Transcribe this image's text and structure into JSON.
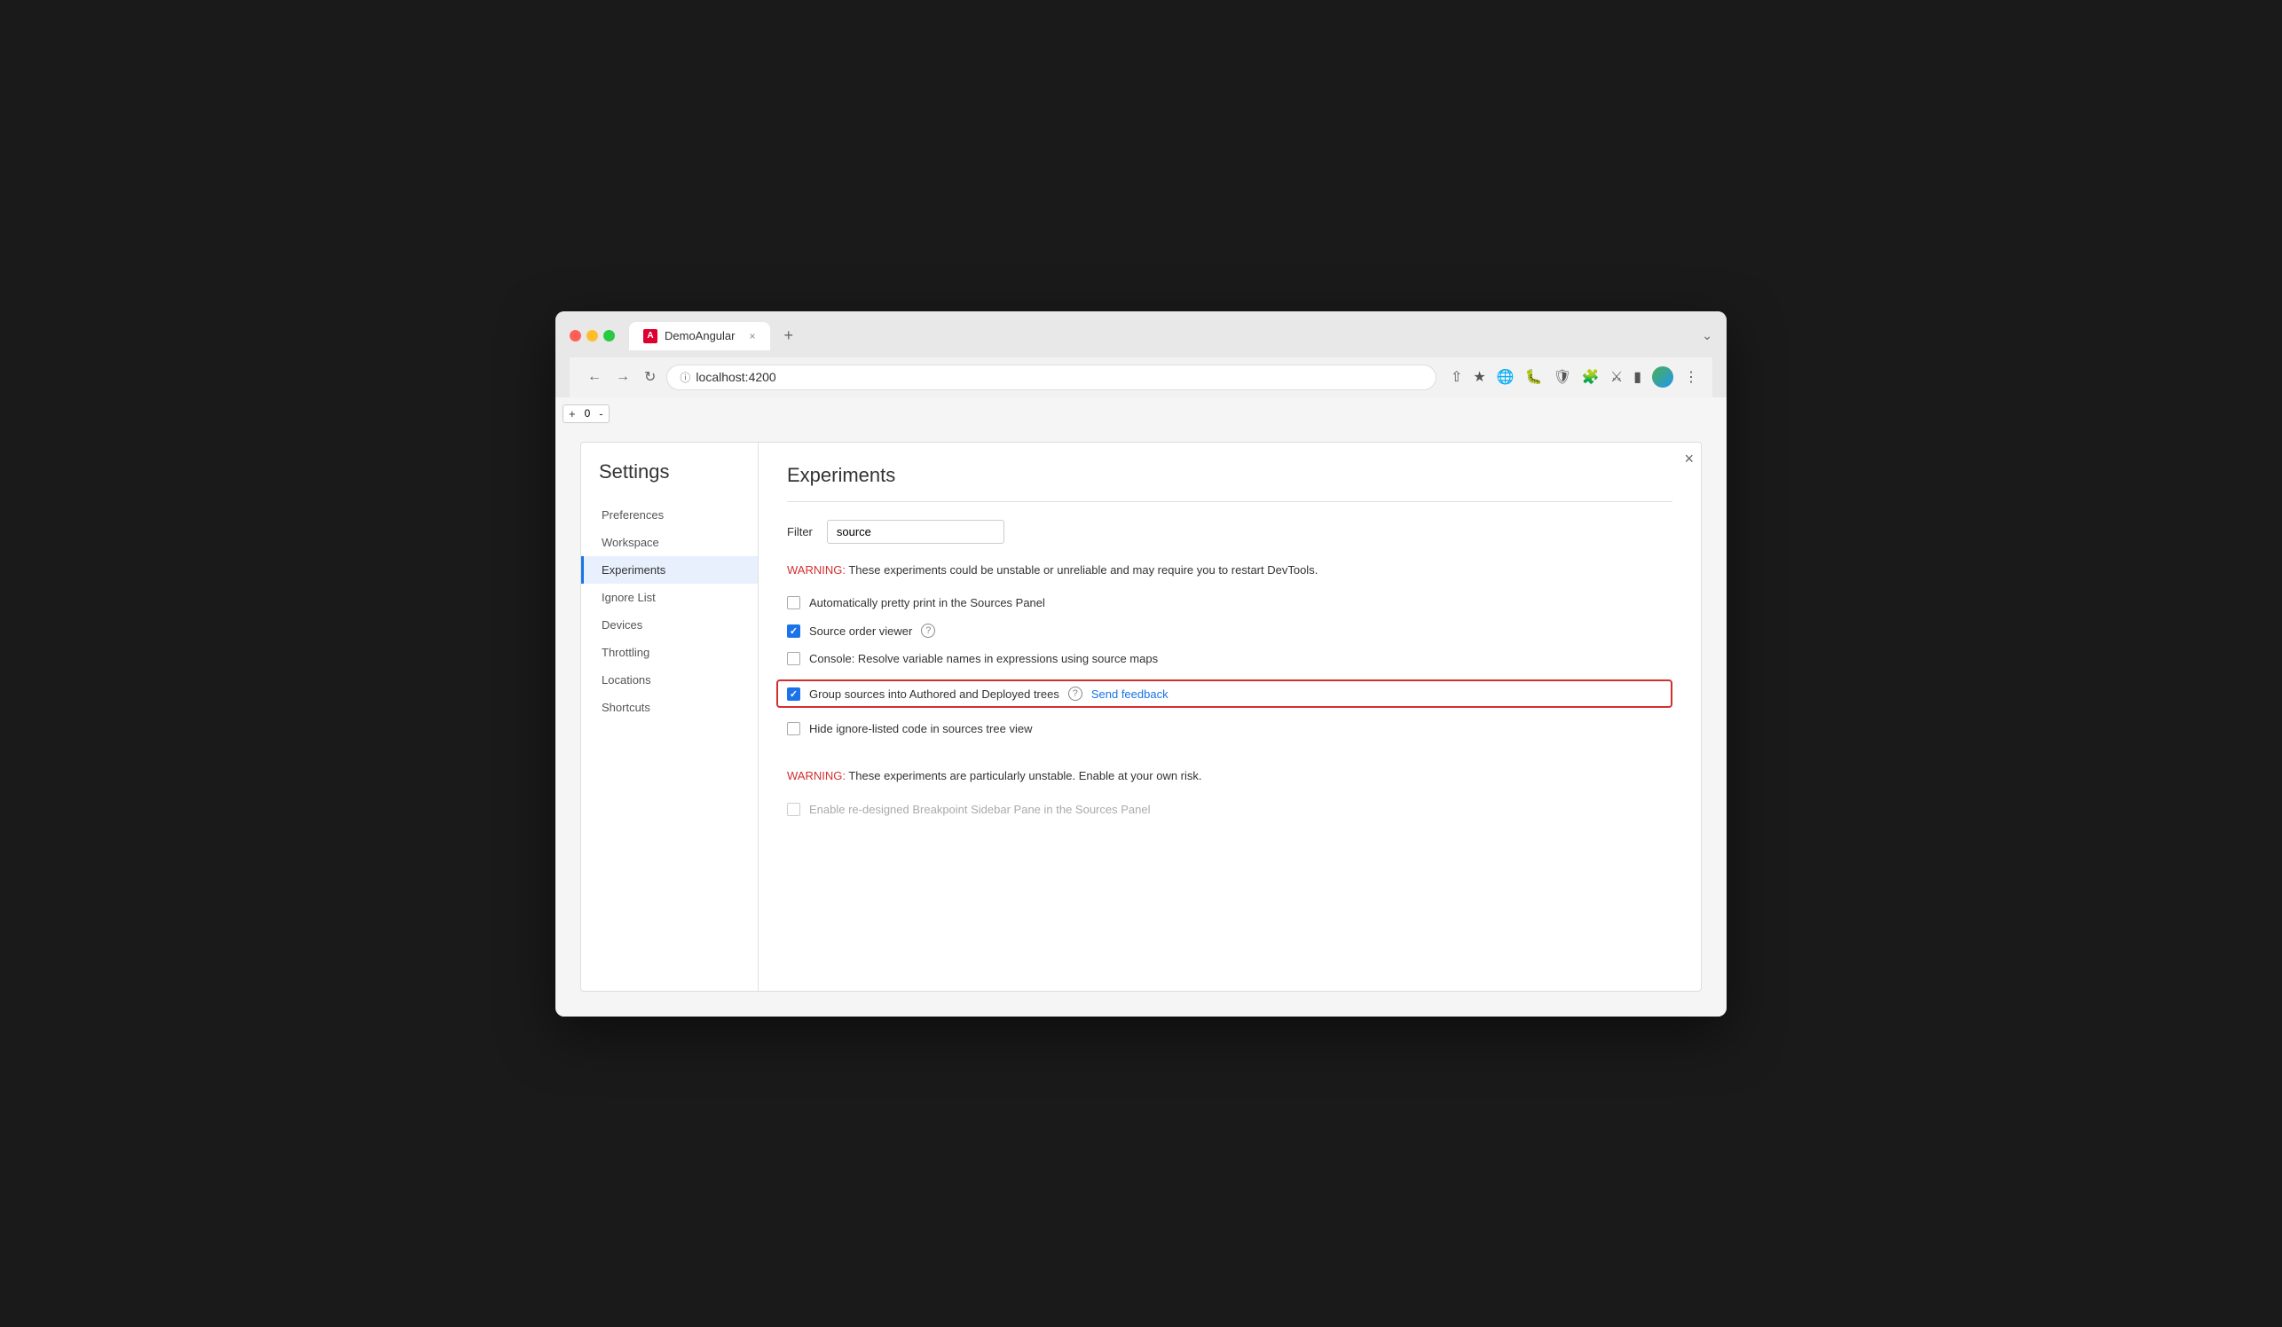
{
  "browser": {
    "tab_title": "DemoAngular",
    "url": "localhost:4200",
    "close_symbol": "×",
    "new_tab_symbol": "+",
    "menu_symbol": "⌄"
  },
  "counter": {
    "plus": "+",
    "value": "0",
    "minus": "-"
  },
  "settings": {
    "panel_title": "Settings",
    "close_symbol": "×",
    "nav_items": [
      {
        "label": "Preferences",
        "active": false
      },
      {
        "label": "Workspace",
        "active": false
      },
      {
        "label": "Experiments",
        "active": true
      },
      {
        "label": "Ignore List",
        "active": false
      },
      {
        "label": "Devices",
        "active": false
      },
      {
        "label": "Throttling",
        "active": false
      },
      {
        "label": "Locations",
        "active": false
      },
      {
        "label": "Shortcuts",
        "active": false
      }
    ],
    "main": {
      "title": "Experiments",
      "filter_label": "Filter",
      "filter_value": "source",
      "warning1": "These experiments could be unstable or unreliable and may require you to restart DevTools.",
      "warning1_prefix": "WARNING:",
      "experiments": [
        {
          "id": "auto-pretty-print",
          "label": "Automatically pretty print in the Sources Panel",
          "checked": false,
          "highlighted": false,
          "has_help": false,
          "has_feedback": false
        },
        {
          "id": "source-order-viewer",
          "label": "Source order viewer",
          "checked": true,
          "highlighted": false,
          "has_help": true,
          "has_feedback": false
        },
        {
          "id": "console-resolve",
          "label": "Console: Resolve variable names in expressions using source maps",
          "checked": false,
          "highlighted": false,
          "has_help": false,
          "has_feedback": false
        },
        {
          "id": "group-sources",
          "label": "Group sources into Authored and Deployed trees",
          "checked": true,
          "highlighted": true,
          "has_help": true,
          "has_feedback": true,
          "feedback_label": "Send feedback"
        },
        {
          "id": "hide-ignore-listed",
          "label": "Hide ignore-listed code in sources tree view",
          "checked": false,
          "highlighted": false,
          "has_help": false,
          "has_feedback": false
        }
      ],
      "warning2": "These experiments are particularly unstable. Enable at your own risk.",
      "warning2_prefix": "WARNING:",
      "unstable_experiments": [
        {
          "id": "redesigned-breakpoint",
          "label": "Enable re-designed Breakpoint Sidebar Pane in the Sources Panel",
          "checked": false,
          "disabled": true
        }
      ]
    }
  }
}
